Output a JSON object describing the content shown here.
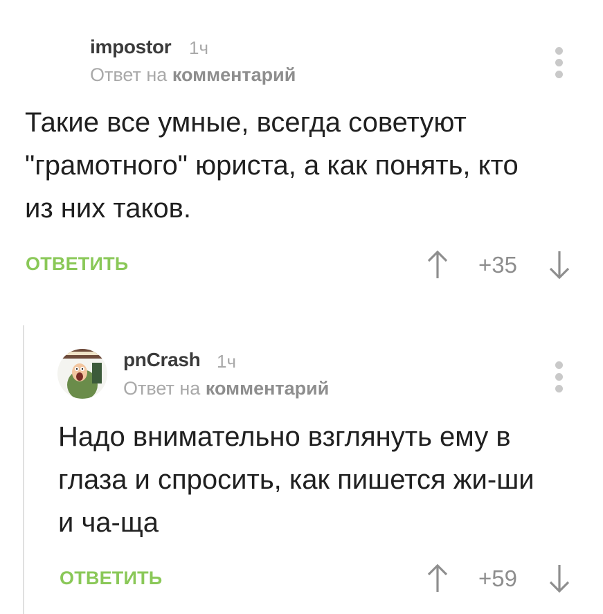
{
  "comments": [
    {
      "username": "impostor",
      "time": "1ч",
      "reply_prefix": "Ответ на",
      "reply_target": "комментарий",
      "text": "Такие все умные, всегда советуют\n\"грамотного\" юриста, а как понять, кто\nиз них таков.",
      "reply_label": "ОТВЕТИТЬ",
      "score": "+35",
      "menu_icon": "more-vertical-icon"
    },
    {
      "username": "pnCrash",
      "time": "1ч",
      "reply_prefix": "Ответ на",
      "reply_target": "комментарий",
      "text": "Надо внимательно взглянуть ему в\nглаза и спросить, как пишется жи-ши\nи ча-ща",
      "reply_label": "ОТВЕТИТЬ",
      "score": "+59",
      "menu_icon": "more-vertical-icon"
    }
  ],
  "colors": {
    "accent_green": "#8ac858",
    "text": "#202020",
    "meta_gray": "#a9a9a9",
    "vote_gray": "#8e8e8e"
  }
}
